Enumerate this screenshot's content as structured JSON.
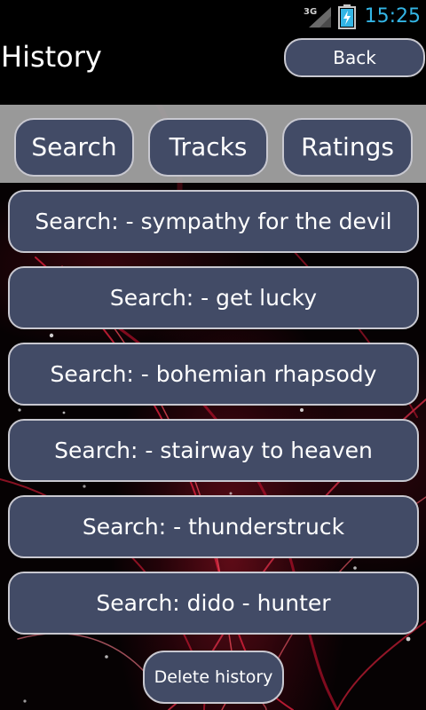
{
  "status_bar": {
    "network_label": "3G",
    "time": "15:25"
  },
  "header": {
    "title": "History",
    "back_label": "Back"
  },
  "tabs": [
    {
      "label": "Search"
    },
    {
      "label": "Tracks"
    },
    {
      "label": "Ratings"
    }
  ],
  "history": {
    "items": [
      {
        "label": "Search:  - sympathy for the devil"
      },
      {
        "label": "Search:  - get lucky"
      },
      {
        "label": "Search:  - bohemian rhapsody"
      },
      {
        "label": "Search:  - stairway to heaven"
      },
      {
        "label": "Search:  - thunderstruck"
      },
      {
        "label": "Search: dido - hunter"
      }
    ],
    "delete_label": "Delete history"
  },
  "colors": {
    "button_fill": "#424b66",
    "button_border": "#c8c8d0",
    "tab_bar": "#a5a5a5",
    "clock": "#33b5e5"
  },
  "icons": {
    "signal": "signal-3g-icon",
    "battery": "battery-charging-icon"
  }
}
